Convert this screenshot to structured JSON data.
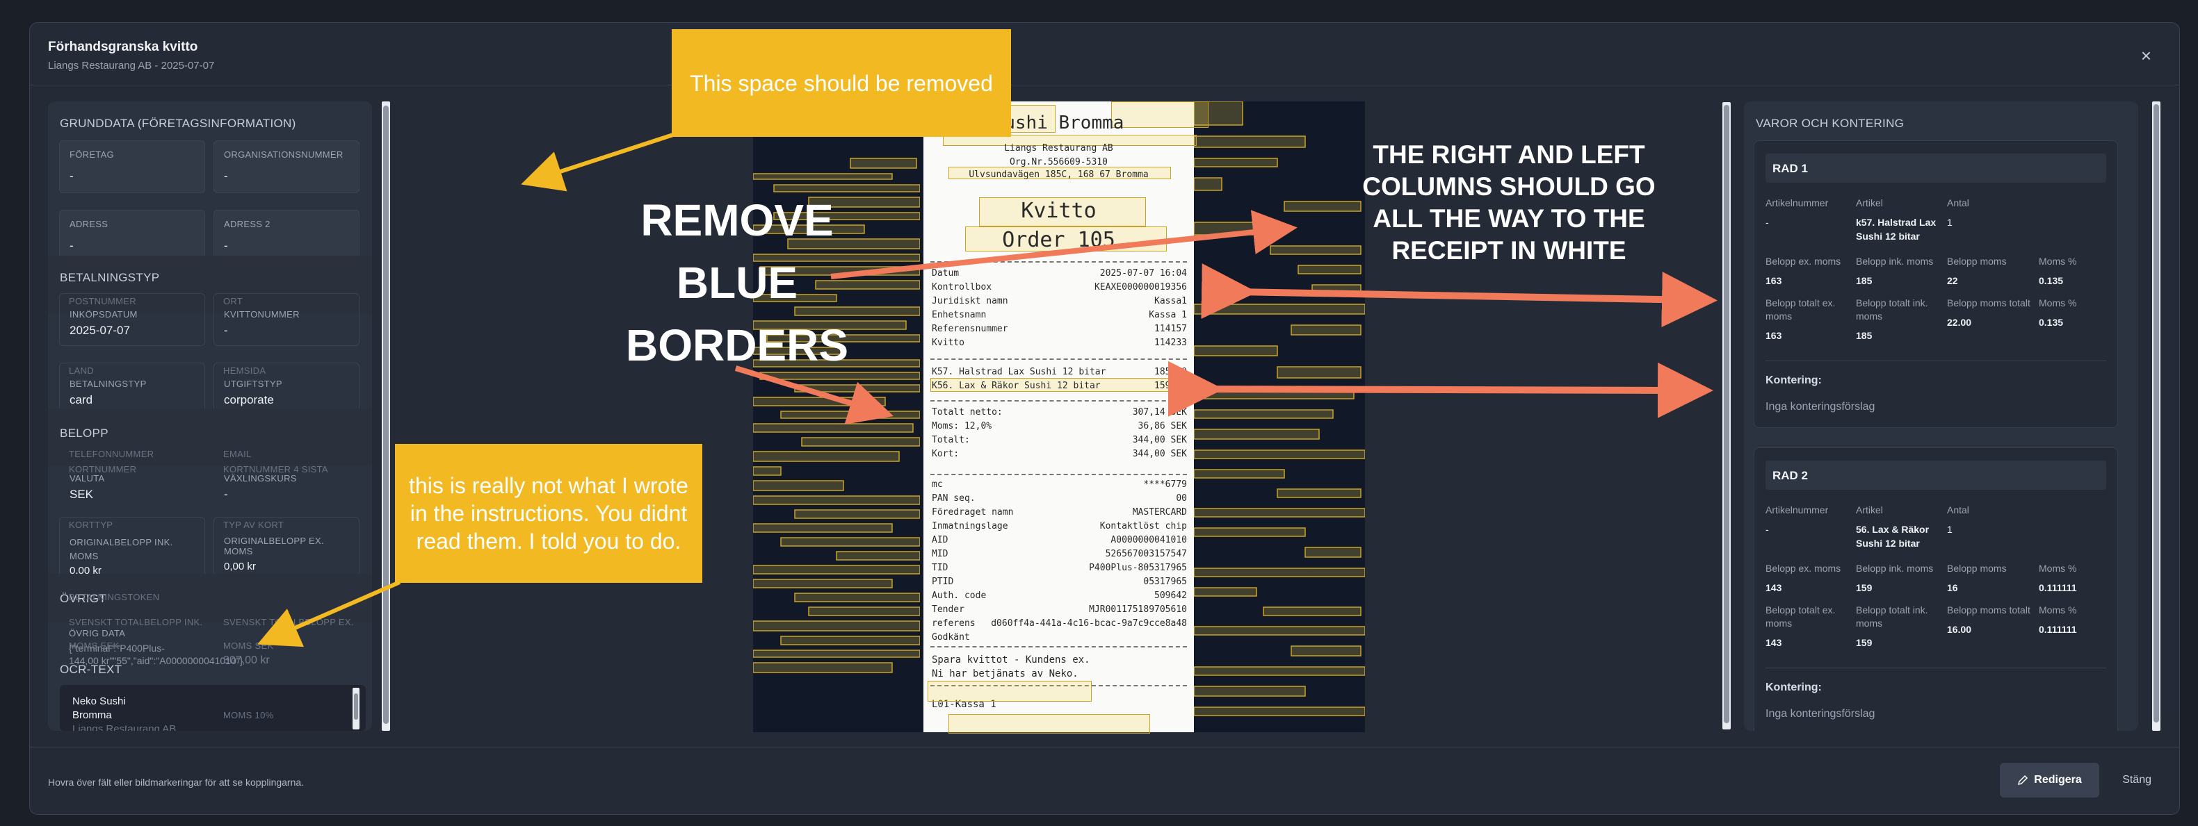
{
  "modal": {
    "title": "Förhandsgranska kvitto",
    "subtitle": "Liangs Restaurang AB - 2025-07-07",
    "close_glyph": "×",
    "footer_hint": "Hovra över fält eller bildmarkeringar för att se kopplingarna.",
    "edit_label": "Redigera",
    "edit_icon": "pencil-icon",
    "close_label": "Stäng"
  },
  "left": {
    "sections": {
      "grunddata": "GRUNDDATA (FÖRETAGSINFORMATION)",
      "betalningstyp": "BETALNINGSTYP",
      "belopp": "BELOPP",
      "ovrigt": "ÖVRIGT",
      "ocr": "OCR-TEXT"
    },
    "fields": {
      "foretag": {
        "label": "FÖRETAG",
        "value": "-"
      },
      "orgnr": {
        "label": "ORGANISATIONSNUMMER",
        "value": "-"
      },
      "adress": {
        "label": "ADRESS",
        "value": "-"
      },
      "adress2": {
        "label": "ADRESS 2",
        "value": "-"
      },
      "inkopsdatum": {
        "label": "INKÖPSDATUM",
        "value": "2025-07-07"
      },
      "kvittonummer": {
        "label": "KVITTONUMMER",
        "value": "-"
      },
      "betalningstyp": {
        "label": "BETALNINGSTYP",
        "value": "card"
      },
      "utgiftstyp": {
        "label": "UTGIFTSTYP",
        "value": "corporate"
      },
      "valuta": {
        "label": "VALUTA",
        "value": "SEK"
      },
      "vaxlingskurs": {
        "label": "VÄXLINGSKURS",
        "value": "-"
      },
      "orig_ink": {
        "label": "ORIGINALBELOPP INK. MOMS",
        "value": "0,00 kr"
      },
      "orig_ex": {
        "label": "ORIGINALBELOPP EX. MOMS",
        "value": "0,00 kr"
      },
      "ovrig_data": {
        "label": "ÖVRIG DATA",
        "value": "{\"terminal\":\"P400Plus-\n144,00 kr\"\"55\",\"aid\":\"A0000000041010\"}"
      }
    },
    "ghosts": {
      "postnummer": "POSTNUMMER",
      "ort": "ORT",
      "land": "LAND",
      "hemsida": "HEMSIDA",
      "telefonnummer": "TELEFONNUMMER",
      "email": "EMAIL",
      "kortnummer": "KORTNUMMER",
      "kortnummer_sista": "KORTNUMMER 4 SISTA",
      "korttyp": "KORTTYP",
      "typ_kort": "TYP AV KORT",
      "betalningstoken": "BETALNINGSTOKEN",
      "summa_ink": "SVENSKT TOTALBELOPP INK.",
      "summa_ex": "SVENSKT TOTALBELOPP EX.",
      "moms_sek": "MOMS SEK",
      "moms_sek_val": "307,00 kr",
      "moms_eek": "MOMS EEK",
      "moms_pct": "MOMS 10%"
    },
    "ocr_lines": [
      "Neko Sushi",
      "Bromma",
      "Liangs Restaurang AB"
    ]
  },
  "receipt": {
    "header_shop": "Sushi Bromma",
    "company": "Liangs Restaurang AB",
    "orgnr": "Org.Nr.556609-5310",
    "address": "Ulvsundavägen 185C, 168 67 Bromma",
    "kvitto": "Kvitto",
    "order": "Order 105",
    "rows1": [
      [
        "Datum",
        "2025-07-07 16:04"
      ],
      [
        "Kontrollbox",
        "KEAXE000000019356"
      ],
      [
        "Juridiskt namn",
        "Kassa1"
      ],
      [
        "Enhetsnamn",
        "Kassa 1"
      ],
      [
        "Referensnummer",
        "114157"
      ],
      [
        "Kvitto",
        "114233"
      ]
    ],
    "items": [
      [
        "K57. Halstrad Lax Sushi 12 bitar",
        "185,00"
      ],
      [
        "K56. Lax & Räkor Sushi 12 bitar",
        "159,00"
      ]
    ],
    "totals": [
      [
        "Totalt netto:",
        "307,14 SEK"
      ],
      [
        "Moms: 12,0%",
        "36,86 SEK"
      ],
      [
        "Totalt:",
        "344,00 SEK"
      ],
      [
        "Kort:",
        "344,00 SEK"
      ]
    ],
    "card": [
      [
        "mc",
        "****6779"
      ],
      [
        "PAN seq.",
        "00"
      ],
      [
        "Föredraget namn",
        "MASTERCARD"
      ],
      [
        "Inmatningslage",
        "Kontaktlöst chip"
      ],
      [
        "AID",
        "A0000000041010"
      ],
      [
        "MID",
        "526567003157547"
      ],
      [
        "TID",
        "P400Plus-805317965"
      ],
      [
        "PTID",
        "05317965"
      ],
      [
        "Auth. code",
        "509642"
      ],
      [
        "Tender",
        "MJR001175189705610"
      ],
      [
        "referens",
        "d060ff4a-441a-4c16-bcac-9a7c9cce8a48"
      ],
      [
        "Godkänt",
        ""
      ]
    ],
    "footer1": "Spara kvittot - Kundens ex.",
    "footer2": "Ni har betjänats av Neko.",
    "footer3": "L01-Kassa 1"
  },
  "right": {
    "header": "VAROR OCH KONTERING",
    "labels": {
      "artnr": "Artikelnummer",
      "artikel": "Artikel",
      "antal": "Antal",
      "bex": "Belopp ex. moms",
      "bink": "Belopp ink. moms",
      "bmoms": "Belopp moms",
      "mpct": "Moms %",
      "btex": "Belopp totalt ex. moms",
      "btink": "Belopp totalt ink. moms",
      "btmoms": "Belopp moms totalt",
      "kontering": "Kontering:",
      "inga": "Inga konteringsförslag"
    },
    "rows": [
      {
        "title": "RAD 1",
        "artnr": "-",
        "artikel": "k57. Halstrad Lax Sushi 12 bitar",
        "antal": "1",
        "bex": "163",
        "bink": "185",
        "bmoms": "22",
        "mpct": "0.135",
        "btex": "163",
        "btink": "185",
        "btmoms": "22.00",
        "mpct2": "0.135"
      },
      {
        "title": "RAD 2",
        "artnr": "-",
        "artikel": "56. Lax & Räkor Sushi 12 bitar",
        "antal": "1",
        "bex": "143",
        "bink": "159",
        "bmoms": "16",
        "mpct": "0.111111",
        "btex": "143",
        "btink": "159",
        "btmoms": "16.00",
        "mpct2": "0.111111"
      }
    ]
  },
  "annotations": {
    "space_removed": "This space should be removed",
    "remove_blue": "REMOVE\nBLUE\nBORDERS",
    "right_left": "THE RIGHT AND LEFT\nCOLUMNS SHOULD GO\nALL THE WAY TO THE\nRECEIPT IN WHITE",
    "not_instructions": "this is really not what I wrote in the instructions. You didnt read them. I told you to do."
  }
}
